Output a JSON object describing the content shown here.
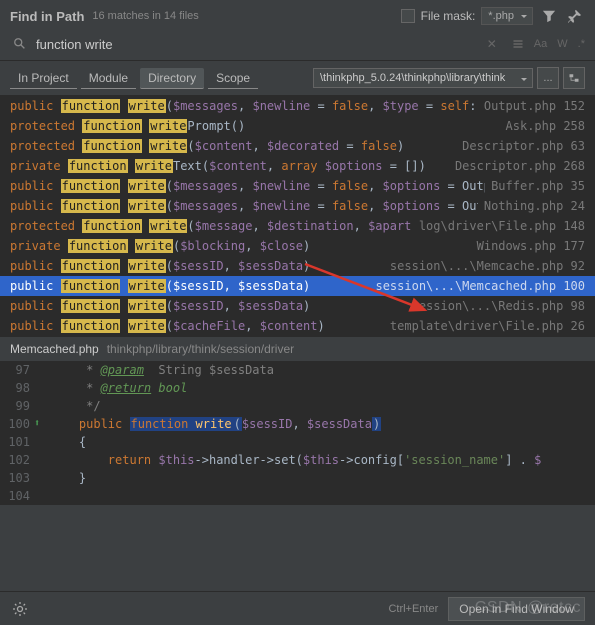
{
  "header": {
    "title": "Find in Path",
    "subtitle": "16 matches in 14 files",
    "filemask_label": "File mask:",
    "filemask_value": "*.php"
  },
  "search": {
    "query": "function write",
    "opts": [
      "Aa",
      "W",
      ".*"
    ]
  },
  "tabs": {
    "items": [
      "In Project",
      "Module",
      "Directory",
      "Scope"
    ],
    "active": 2,
    "path": "\\thinkphp_5.0.24\\thinkphp\\library\\think"
  },
  "results": [
    {
      "vis": "public",
      "pre": "",
      "post": "($messages, $newline = false, $type = self::OUTPUT_NORMAL)",
      "file": "Output.php",
      "line": "152"
    },
    {
      "vis": "protected",
      "pre": "",
      "post": "Prompt()",
      "file": "Ask.php",
      "line": "258"
    },
    {
      "vis": "protected",
      "pre": "",
      "post": "($content, $decorated = false)",
      "file": "Descriptor.php",
      "line": "63"
    },
    {
      "vis": "private",
      "pre": "",
      "post": "Text($content, array $options = [])",
      "file": "Descriptor.php",
      "line": "268"
    },
    {
      "vis": "public",
      "pre": "",
      "post": "($messages, $newline = false, $options = Output::OUTPUT_NORM",
      "file": "Buffer.php",
      "line": "35"
    },
    {
      "vis": "public",
      "pre": "",
      "post": "($messages, $newline = false, $options = Output::OUTPUT_NO",
      "file": "Nothing.php",
      "line": "24"
    },
    {
      "vis": "protected",
      "pre": "",
      "post": "($message, $destination, $apart = false, $append =",
      "file": "log\\driver\\File.php",
      "line": "148"
    },
    {
      "vis": "private",
      "pre": "",
      "post": "($blocking, $close)",
      "file": "Windows.php",
      "line": "177"
    },
    {
      "vis": "public",
      "pre": "",
      "post": "($sessID, $sessData)",
      "file": "session\\...\\Memcache.php",
      "line": "92"
    },
    {
      "vis": "public",
      "pre": "",
      "post": "($sessID, $sessData)",
      "file": "session\\...\\Memcached.php",
      "line": "100",
      "selected": true
    },
    {
      "vis": "public",
      "pre": "",
      "post": "($sessID, $sessData)",
      "file": "session\\...\\Redis.php",
      "line": "98"
    },
    {
      "vis": "public",
      "pre": "",
      "post": "($cacheFile, $content)",
      "file": "template\\driver\\File.php",
      "line": "26"
    }
  ],
  "preview": {
    "file": "Memcached.php",
    "path": "thinkphp/library/think/session/driver",
    "lines": [
      {
        "n": "97",
        "mark": "",
        "html": "     <span class='c-com'>* </span><span class='c-tag'>@param</span>  <span class='c-com'>String $sessData</span>"
      },
      {
        "n": "98",
        "mark": "",
        "html": "     <span class='c-com'>* </span><span class='c-tag'>@return</span> <span class='c-doc'>bool</span>"
      },
      {
        "n": "99",
        "mark": "",
        "html": "     <span class='c-com'>*/</span>"
      },
      {
        "n": "100",
        "mark": "⬆",
        "html": "    <span class='c-kw'>public</span> <span class='c-fn-bg'><span class='c-kw'>function</span> <span class='c-fn'>write</span></span><span class='c-fn-bg'>(</span><span class='c-var'>$sessID</span>, <span class='c-var'>$sessData</span><span class='c-fn-bg'>)</span>"
      },
      {
        "n": "101",
        "mark": "",
        "html": "    {"
      },
      {
        "n": "102",
        "mark": "",
        "html": "        <span class='c-kw'>return</span> <span class='c-var'>$this</span>-&gt;<span>handler</span>-&gt;set(<span class='c-var'>$this</span>-&gt;<span>config</span>[<span class='c-str'>'session_name'</span>] . <span class='c-var'>$</span>"
      },
      {
        "n": "103",
        "mark": "",
        "html": "    }"
      },
      {
        "n": "104",
        "mark": "",
        "html": " "
      }
    ]
  },
  "footer": {
    "hint": "Ctrl+Enter",
    "open": "Open in Find Window"
  },
  "watermark": "CSDN @retcc"
}
